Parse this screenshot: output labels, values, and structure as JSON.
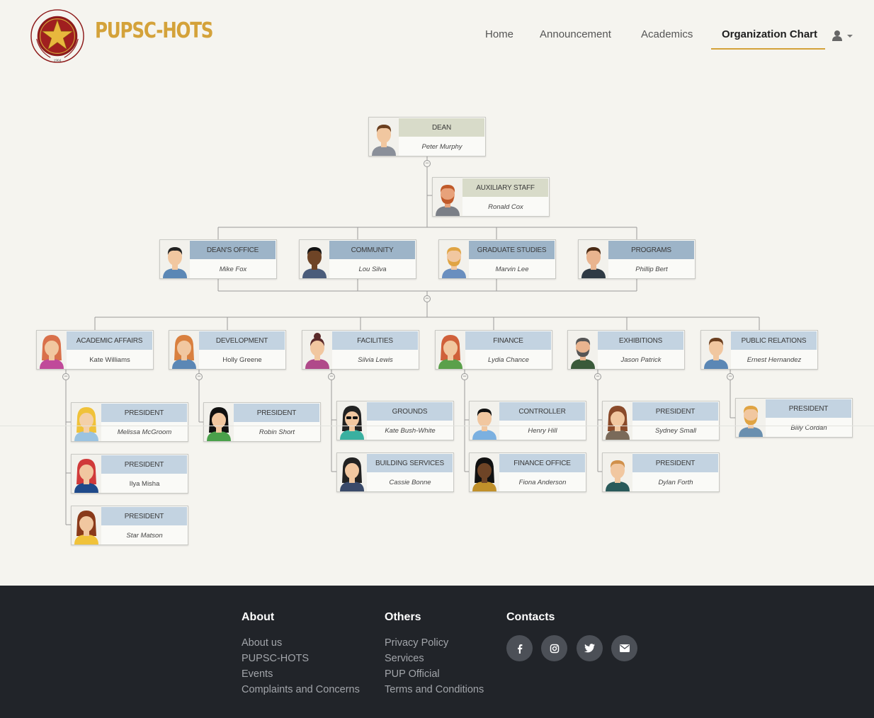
{
  "brand": {
    "name": "PUPSC-HOTS",
    "seal_text": "POLYTECHNIC UNIVERSITY OF THE PHILIPPINES",
    "seal_year": "1904"
  },
  "nav": {
    "items": [
      {
        "label": "Home",
        "active": false
      },
      {
        "label": "Announcement",
        "active": false
      },
      {
        "label": "Academics",
        "active": false
      },
      {
        "label": "Organization Chart",
        "active": true
      }
    ],
    "user_icon": "user-icon",
    "caret_icon": "caret-down-icon"
  },
  "org_chart": {
    "dean": {
      "role": "DEAN",
      "name": "Peter Murphy"
    },
    "auxiliary": {
      "role": "AUXILIARY STAFF",
      "name": "Ronald Cox"
    },
    "offices": [
      {
        "role": "DEAN'S OFFICE",
        "name": "Mike Fox"
      },
      {
        "role": "COMMUNITY",
        "name": "Lou Silva"
      },
      {
        "role": "GRADUATE STUDIES",
        "name": "Marvin Lee"
      },
      {
        "role": "PROGRAMS",
        "name": "Phillip Bert"
      }
    ],
    "departments": [
      {
        "role": "ACADEMIC AFFAIRS",
        "name": "Kate Williams"
      },
      {
        "role": "DEVELOPMENT",
        "name": "Holly Greene"
      },
      {
        "role": "FACILITIES",
        "name": "Silvia Lewis"
      },
      {
        "role": "FINANCE",
        "name": "Lydia Chance"
      },
      {
        "role": "EXHIBITIONS",
        "name": "Jason Patrick"
      },
      {
        "role": "PUBLIC RELATIONS",
        "name": "Ernest Hernandez"
      }
    ],
    "sub_units": [
      {
        "role": "PRESIDENT",
        "name": "Melissa McGroom"
      },
      {
        "role": "PRESIDENT",
        "name": "Ilya Misha"
      },
      {
        "role": "PRESIDENT",
        "name": "Star Matson"
      },
      {
        "role": "PRESIDENT",
        "name": "Robin Short"
      },
      {
        "role": "GROUNDS",
        "name": "Kate Bush-White"
      },
      {
        "role": "BUILDING SERVICES",
        "name": "Cassie Bonne"
      },
      {
        "role": "CONTROLLER",
        "name": "Henry Hill"
      },
      {
        "role": "FINANCE OFFICE",
        "name": "Fiona Anderson"
      },
      {
        "role": "PRESIDENT",
        "name": "Sydney Small"
      },
      {
        "role": "PRESIDENT",
        "name": "Dylan Forth"
      },
      {
        "role": "PRESIDENT",
        "name": "Billy Cordan"
      }
    ]
  },
  "footer": {
    "about": {
      "title": "About",
      "links": [
        "About us",
        "PUPSC-HOTS",
        "Events",
        "Complaints and Concerns"
      ]
    },
    "others": {
      "title": "Others",
      "links": [
        "Privacy Policy",
        "Services",
        "PUP Official",
        "Terms and Conditions"
      ]
    },
    "contacts": {
      "title": "Contacts",
      "icons": [
        "facebook-icon",
        "instagram-icon",
        "twitter-icon",
        "email-icon"
      ]
    }
  },
  "colors": {
    "brand_gold": "#d4a23a",
    "seal_red": "#8e1b1b",
    "footer_bg": "#212429",
    "card_header_blue": "#c3d3e1",
    "card_header_steel": "#9db4c8",
    "card_header_olive": "#d8dbc9"
  }
}
